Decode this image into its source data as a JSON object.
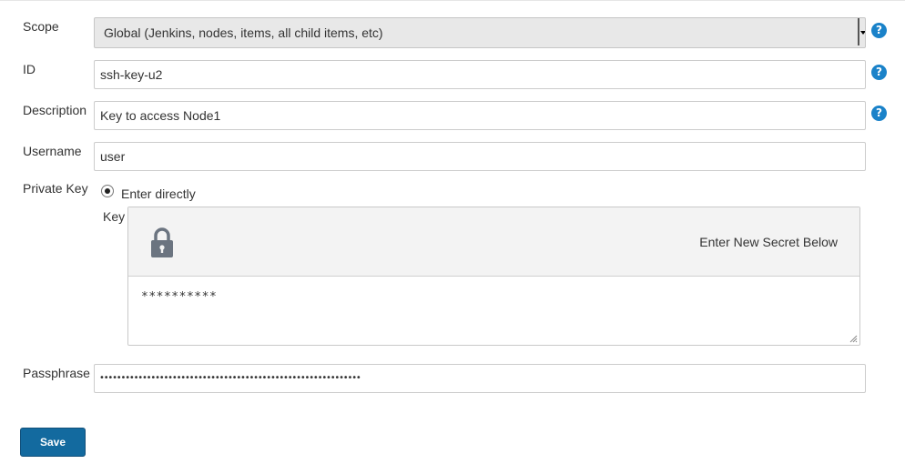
{
  "form": {
    "scope": {
      "label": "Scope",
      "value": "Global (Jenkins, nodes, items, all child items, etc)"
    },
    "id": {
      "label": "ID",
      "value": "ssh-key-u2"
    },
    "description": {
      "label": "Description",
      "value": "Key to access Node1"
    },
    "username": {
      "label": "Username",
      "value": "user"
    },
    "private_key": {
      "label": "Private Key",
      "option_label": "Enter directly",
      "key_label": "Key",
      "secret_title": "Enter New Secret Below",
      "secret_value": "**********"
    },
    "passphrase": {
      "label": "Passphrase",
      "value": "•••••••••••••••••••••••••••••••••••••••••••••••••••••••••••••"
    },
    "help_symbol": "?",
    "save_label": "Save"
  },
  "icons": {
    "help": "help-icon",
    "lock": "lock-icon",
    "dropdown": "chevron-down-icon",
    "resize": "resize-grip-icon"
  },
  "colors": {
    "primary_button": "#136a9f",
    "help_icon": "#1a82c9",
    "lock_icon": "#6b7480"
  }
}
